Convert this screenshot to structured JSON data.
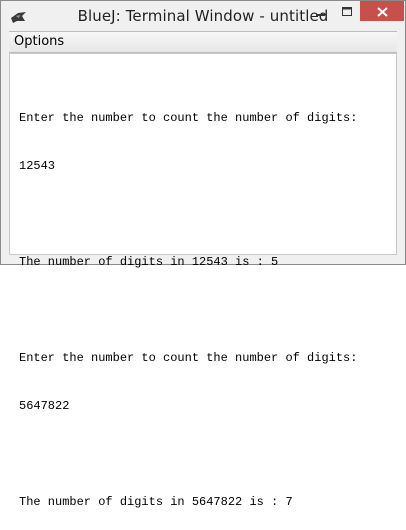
{
  "window": {
    "title": "BlueJ: Terminal Window - untitled",
    "close_color": "#c7504a"
  },
  "menubar": {
    "items": [
      {
        "label": "Options"
      }
    ]
  },
  "terminal": {
    "lines": [
      "Enter the number to count the number of digits:",
      "12543",
      "",
      "The number of digits in 12543 is : 5",
      "",
      "Enter the number to count the number of digits:",
      "5647822",
      "",
      "The number of digits in 5647822 is : 7"
    ]
  }
}
